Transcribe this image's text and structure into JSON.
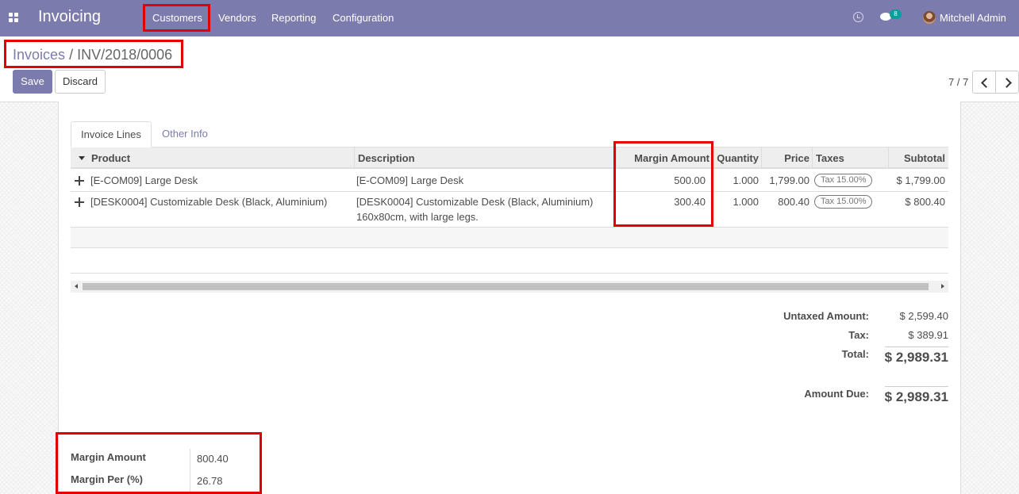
{
  "navbar": {
    "app_title": "Invoicing",
    "menu": [
      "Customers",
      "Vendors",
      "Reporting",
      "Configuration"
    ],
    "chat_count": "8",
    "user_name": "Mitchell Admin",
    "bg_color": "#7c7bad"
  },
  "breadcrumb": {
    "parent": "Invoices",
    "separator": "/",
    "current": "INV/2018/0006"
  },
  "buttons": {
    "save": "Save",
    "discard": "Discard"
  },
  "pager": {
    "value": "7 / 7"
  },
  "tabs": {
    "invoice_lines": "Invoice Lines",
    "other_info": "Other Info"
  },
  "table": {
    "headers": {
      "product": "Product",
      "description": "Description",
      "margin_amount": "Margin Amount",
      "quantity": "Quantity",
      "price": "Price",
      "taxes": "Taxes",
      "subtotal": "Subtotal"
    },
    "rows": [
      {
        "product": "[E-COM09] Large Desk",
        "description": [
          "[E-COM09] Large Desk"
        ],
        "margin_amount": "500.00",
        "quantity": "1.000",
        "price": "1,799.00",
        "tax": "Tax 15.00%",
        "subtotal": "$ 1,799.00"
      },
      {
        "product": "[DESK0004] Customizable Desk (Black, Aluminium)",
        "description": [
          "[DESK0004] Customizable Desk (Black, Aluminium)",
          "160x80cm, with large legs."
        ],
        "margin_amount": "300.40",
        "quantity": "1.000",
        "price": "800.40",
        "tax": "Tax 15.00%",
        "subtotal": "$ 800.40"
      }
    ]
  },
  "totals": {
    "untaxed_label": "Untaxed Amount:",
    "untaxed_value": "$ 2,599.40",
    "tax_label": "Tax:",
    "tax_value": "$ 389.91",
    "total_label": "Total:",
    "total_value": "$ 2,989.31",
    "due_label": "Amount Due:",
    "due_value": "$ 2,989.31"
  },
  "margin": {
    "amount_label": "Margin Amount",
    "amount_value": "800.40",
    "percent_label": "Margin Per (%)",
    "percent_value": "26.78"
  },
  "highlight_color": "#e20000"
}
